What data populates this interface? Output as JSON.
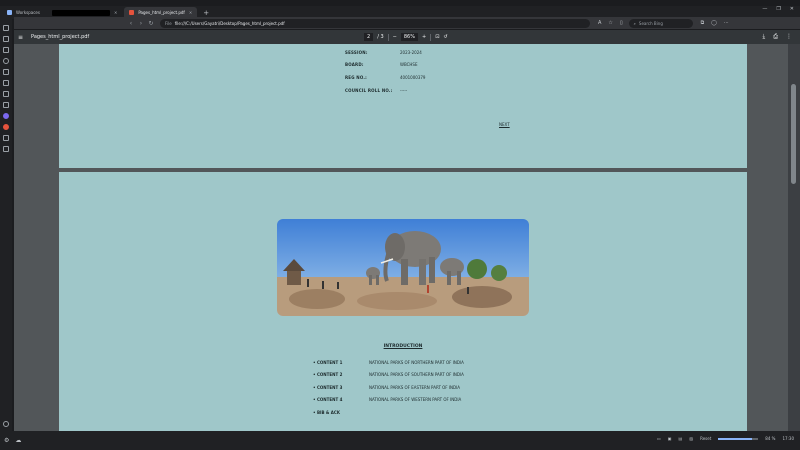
{
  "tabs": [
    {
      "label": "Workspaces",
      "active": false
    },
    {
      "label": "",
      "redacted": true
    },
    {
      "label": "Pages_html_project.pdf",
      "active": true
    }
  ],
  "toolbar": {
    "url_scheme": "File",
    "url": "file:///C:/Users/Gayatri/Desktop/Pages_html_project.pdf",
    "search_placeholder": "Search Bing"
  },
  "pdf": {
    "title": "Pages_html_project.pdf",
    "current_page": "2",
    "total_pages": "/ 3",
    "zoom": "86%"
  },
  "page1": {
    "fields": [
      {
        "key": "SESSION:",
        "value": "2023-2024"
      },
      {
        "key": "BOARD:",
        "value": "WBCHSE"
      },
      {
        "key": "REG NO.:",
        "value": "4001000379"
      },
      {
        "key": "COUNCIL ROLL NO.:",
        "value": "-----"
      }
    ],
    "next_label": "NEXT"
  },
  "page2": {
    "heading": "INTRODUCTION",
    "contents": [
      {
        "key": "• CONTENT 1",
        "value": "NATIONAL PARKS OF NORTHERN PART OF INDIA"
      },
      {
        "key": "• CONTENT 2",
        "value": "NATIONAL PARKS OF SOUTHERN PART OF INDIA"
      },
      {
        "key": "• CONTENT 3",
        "value": "NATIONAL PARKS OF EASTERN PART OF INDIA"
      },
      {
        "key": "• CONTENT 4",
        "value": "NATIONAL PARKS OF WESTERN PART OF INDIA"
      },
      {
        "key": "• BIB & ACK",
        "value": ""
      }
    ]
  },
  "status": {
    "zoom_label": "Reset",
    "zoom_value": "84 %",
    "zoom_fraction": 0.84,
    "time": "17:30"
  },
  "colors": {
    "page_bg": "#9fc7c9",
    "viewer_bg": "#525659",
    "chrome_bg": "#202124"
  }
}
